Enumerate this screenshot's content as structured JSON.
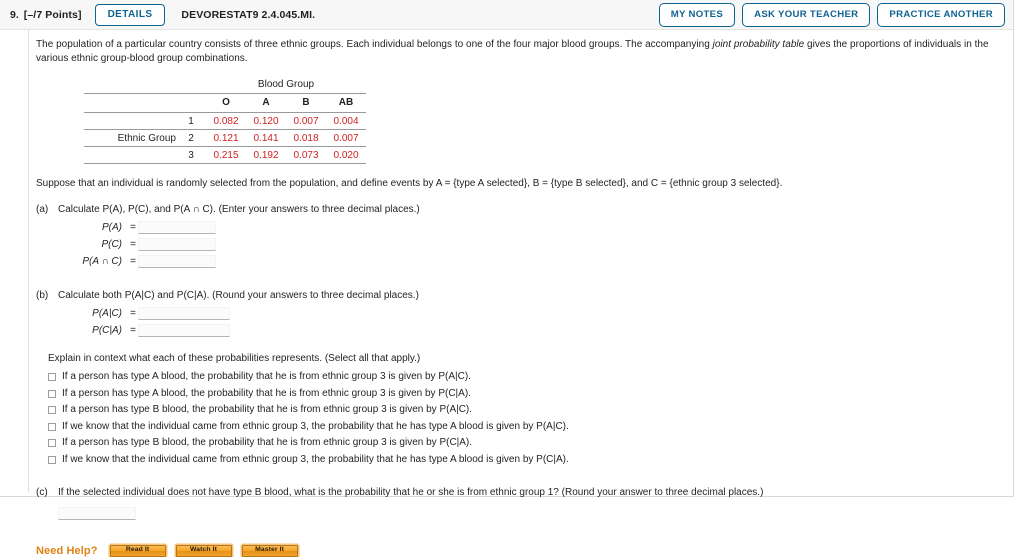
{
  "header": {
    "question_number": "9.",
    "points": "[–/7 Points]",
    "details_label": "DETAILS",
    "question_code": "DEVORESTAT9 2.4.045.MI.",
    "my_notes_label": "MY NOTES",
    "ask_teacher_label": "ASK YOUR TEACHER",
    "practice_another_label": "PRACTICE ANOTHER",
    "accent_color": "#0f6391"
  },
  "prompt": {
    "text_1": "The population of a particular country consists of three ethnic groups. Each individual belongs to one of the four major blood groups. The accompanying ",
    "italic": "joint probability table",
    "text_2": " gives the proportions of individuals in the various ethnic group-blood group combinations."
  },
  "table": {
    "blood_group_header": "Blood Group",
    "ethnic_group_label": "Ethnic Group",
    "columns": [
      "O",
      "A",
      "B",
      "AB"
    ],
    "rows": [
      {
        "index": "1",
        "values": [
          "0.082",
          "0.120",
          "0.007",
          "0.004"
        ]
      },
      {
        "index": "2",
        "values": [
          "0.121",
          "0.141",
          "0.018",
          "0.007"
        ]
      },
      {
        "index": "3",
        "values": [
          "0.215",
          "0.192",
          "0.073",
          "0.020"
        ]
      }
    ],
    "value_color": "#d01f1f"
  },
  "suppose_text": "Suppose that an individual is randomly selected from the population, and define events by A = {type A selected}, B = {type B selected}, and C = {ethnic group 3 selected}.",
  "parts": {
    "a": {
      "tag": "(a)",
      "text": "Calculate P(A), P(C), and P(A ∩ C). (Enter your answers to three decimal places.)",
      "fields": [
        {
          "label": "P(A)",
          "eq": "=",
          "value": ""
        },
        {
          "label": "P(C)",
          "eq": "=",
          "value": ""
        },
        {
          "label": "P(A ∩ C)",
          "eq": "=",
          "value": ""
        }
      ]
    },
    "b": {
      "tag": "(b)",
      "text": "Calculate both P(A|C) and P(C|A). (Round your answers to three decimal places.)",
      "fields": [
        {
          "label": "P(A|C)",
          "eq": "=",
          "value": ""
        },
        {
          "label": "P(C|A)",
          "eq": "=",
          "value": ""
        }
      ],
      "explain_text": "Explain in context what each of these probabilities represents. (Select all that apply.)",
      "options": [
        {
          "text": "If a person has type A blood, the probability that he is from ethnic group 3 is given by P(A|C).",
          "checked": false
        },
        {
          "text": "If a person has type A blood, the probability that he is from ethnic group 3 is given by P(C|A).",
          "checked": false
        },
        {
          "text": "If a person has type B blood, the probability that he is from ethnic group 3 is given by P(A|C).",
          "checked": false
        },
        {
          "text": "If we know that the individual came from ethnic group 3, the probability that he has type A blood is given by P(A|C).",
          "checked": false
        },
        {
          "text": "If a person has type B blood, the probability that he is from ethnic group 3 is given by P(C|A).",
          "checked": false
        },
        {
          "text": "If we know that the individual came from ethnic group 3, the probability that he has type A blood is given by P(C|A).",
          "checked": false
        }
      ]
    },
    "c": {
      "tag": "(c)",
      "text": "If the selected individual does not have type B blood, what is the probability that he or she is from ethnic group 1? (Round your answer to three decimal places.)",
      "value": ""
    }
  },
  "need_help": {
    "label": "Need Help?",
    "buttons": [
      "Read It",
      "Watch It",
      "Master It"
    ],
    "color": "#e08214"
  }
}
